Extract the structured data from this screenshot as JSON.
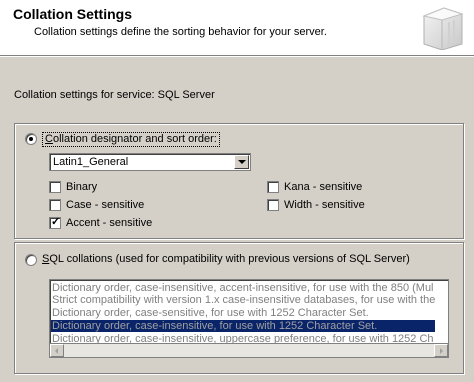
{
  "header": {
    "title": "Collation Settings",
    "subtitle": "Collation settings define the sorting behavior for your server."
  },
  "service_label": "Collation settings for service: SQL Server",
  "collation_designator": {
    "label_underlined": "C",
    "label_rest": "ollation designator and sort order:",
    "selected": true,
    "dropdown_value": "Latin1_General",
    "checkboxes": [
      {
        "label": "Binary",
        "checked": false
      },
      {
        "label": "Case - sensitive",
        "checked": false
      },
      {
        "label": "Accent - sensitive",
        "checked": true
      },
      {
        "label": "Kana - sensitive",
        "checked": false
      },
      {
        "label": "Width - sensitive",
        "checked": false
      }
    ]
  },
  "sql_collations": {
    "label_underlined": "S",
    "label_rest": "QL collations (used for compatibility with previous versions of SQL Server)",
    "selected": false,
    "items": [
      "Dictionary order, case-insensitive, accent-insensitive, for use with the 850 (Mul",
      "Strict compatibility with version 1.x case-insensitive databases, for use with the",
      "Dictionary order, case-sensitive, for use with 1252 Character Set.",
      "Dictionary order, case-insensitive, for use with 1252 Character Set.",
      "Dictionary order, case-insensitive, uppercase preference, for use with 1252 Ch"
    ],
    "selected_index": 3
  },
  "icons": {
    "radio_dot": "radio-dot-icon",
    "check": "check-icon",
    "dropdown_arrow": "chevron-down-icon",
    "scroll_left": "arrow-left-icon",
    "scroll_right": "arrow-right-icon"
  }
}
